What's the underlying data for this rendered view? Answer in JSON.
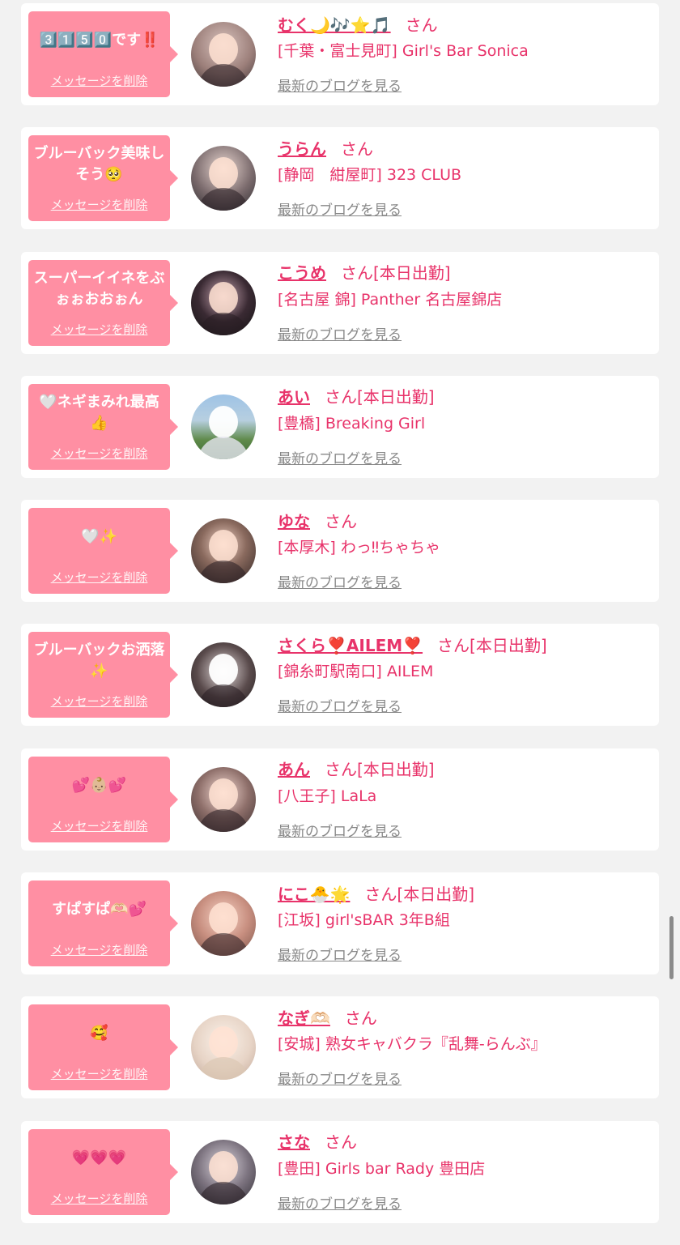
{
  "common": {
    "delete_label": "メッセージを削除",
    "blog_label": "最新のブログを見る"
  },
  "colors": {
    "background": "#f2f2f2",
    "card": "#ffffff",
    "bubble": "#ff8fa3",
    "accent": "#e8336a",
    "link_gray": "#888888"
  },
  "items": [
    {
      "message": "3️⃣1️⃣5️⃣0️⃣です‼️",
      "name": "むく🌙🎶⭐️🎵",
      "suffix": "さん",
      "shop": "[千葉・富士見町] Girl's Bar Sonica"
    },
    {
      "message": "ブルーバック美味しそう🥺",
      "name": "うらん",
      "suffix": "さん",
      "shop": "[静岡　紺屋町] 323 CLUB"
    },
    {
      "message": "スーパーイイネをぶぉぉおおぉん",
      "name": "こうめ",
      "suffix": "さん[本日出勤]",
      "shop": "[名古屋 錦] Panther 名古屋錦店"
    },
    {
      "message": "🤍ネギまみれ最高👍",
      "name": "あい",
      "suffix": "さん[本日出勤]",
      "shop": "[豊橋] Breaking Girl"
    },
    {
      "message": "🤍✨",
      "name": "ゆな",
      "suffix": "さん",
      "shop": "[本厚木] わっ‼ちゃちゃ"
    },
    {
      "message": "ブルーバックお洒落✨",
      "name": "さくら❣️AILEM❣️",
      "suffix": "さん[本日出勤]",
      "shop": "[錦糸町駅南口] AILEM"
    },
    {
      "message": "💕👶🏼💕",
      "name": "あん",
      "suffix": "さん[本日出勤]",
      "shop": "[八王子] LaLa"
    },
    {
      "message": "すぱすぱ🫶🏻💕",
      "name": "にこ🐣🌟",
      "suffix": "さん[本日出勤]",
      "shop": "[江坂] girl'sBAR 3年B組"
    },
    {
      "message": "🥰",
      "name": "なぎ🫶🏻",
      "suffix": "さん",
      "shop": "[安城] 熟女キャバクラ『乱舞-らんぶ』"
    },
    {
      "message": "💗💗💗",
      "name": "さな",
      "suffix": "さん",
      "shop": "[豊田] Girls bar Rady 豊田店"
    }
  ]
}
